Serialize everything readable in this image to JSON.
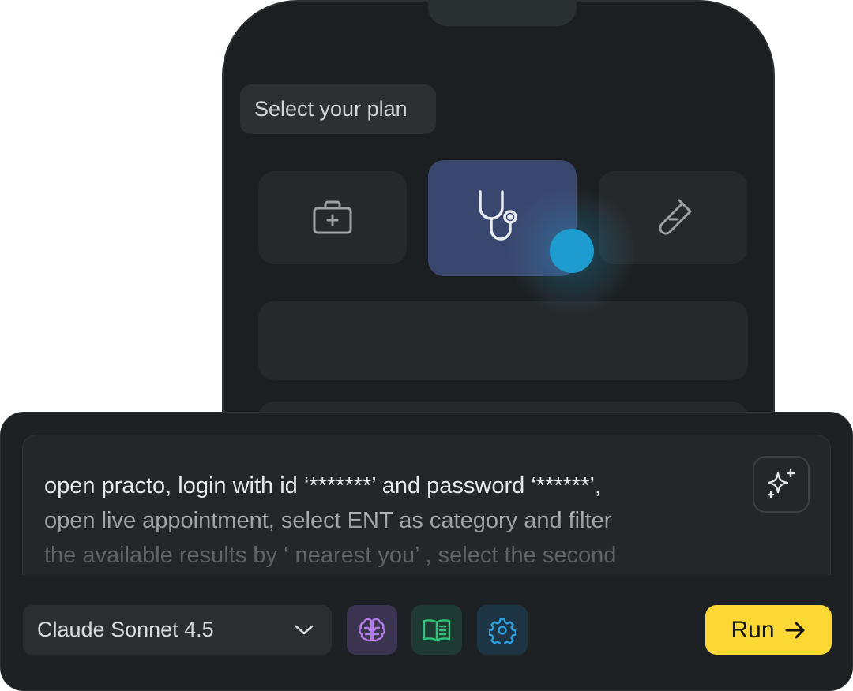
{
  "phone": {
    "plan_label": "Select your plan",
    "plan_options": [
      {
        "icon": "first-aid-kit-icon",
        "selected": false
      },
      {
        "icon": "stethoscope-icon",
        "selected": true
      },
      {
        "icon": "test-tube-icon",
        "selected": false
      }
    ]
  },
  "prompt": {
    "lines": [
      "open practo, login with id ‘*******’ and password ‘******’,",
      "open live appointment, select ENT as category and filter",
      "the available results by ‘ nearest you’ , select the second"
    ],
    "enhance_icon": "sparkle-icon"
  },
  "toolbar": {
    "model": "Claude Sonnet 4.5",
    "model_chevron_icon": "chevron-down-icon",
    "tools": [
      {
        "icon": "brain-icon",
        "color": "#b27be8"
      },
      {
        "icon": "book-icon",
        "color": "#2fc27a"
      },
      {
        "icon": "gear-icon",
        "color": "#2aa0e0"
      }
    ],
    "run_label": "Run",
    "run_icon": "arrow-right-icon"
  },
  "colors": {
    "accent_yellow": "#fcd835",
    "selected_card": "#39476f",
    "cursor_dot": "#1e9cd0"
  }
}
